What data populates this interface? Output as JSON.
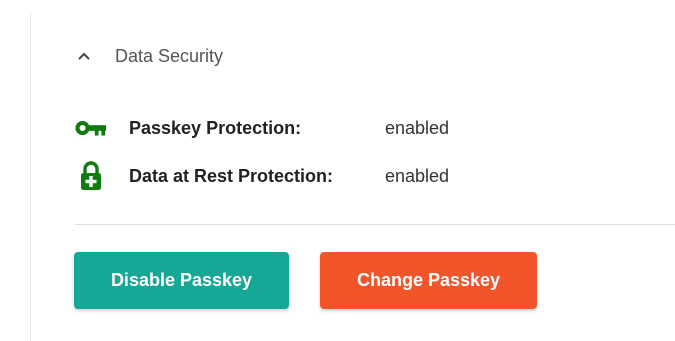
{
  "section": {
    "title": "Data Security",
    "expanded": true,
    "chevron_icon": "chevron-up-icon"
  },
  "rows": [
    {
      "icon": "key-icon",
      "label": "Passkey Protection:",
      "value": "enabled"
    },
    {
      "icon": "lock-plus-icon",
      "label": "Data at Rest Protection:",
      "value": "enabled"
    }
  ],
  "buttons": {
    "disable_label": "Disable Passkey",
    "change_label": "Change Passkey"
  },
  "colors": {
    "icon_green": "#0e7d0e",
    "disable_button": "#15a896",
    "change_button": "#f2552a"
  }
}
